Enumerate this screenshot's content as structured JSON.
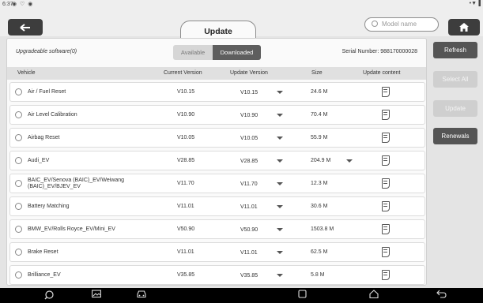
{
  "status_bar": {
    "time": "6:37",
    "icons": "◉ ♡ ◉",
    "right": "•▼▐"
  },
  "header": {
    "title": "Update",
    "search_placeholder": "Model name",
    "back_icon": "back-arrow-icon",
    "home_icon": "home-icon"
  },
  "panel": {
    "upgradeable_label": "Upgradeable software(0)",
    "tab_available": "Available",
    "tab_downloaded": "Downloaded",
    "serial": "Serial Number:  988170000028"
  },
  "columns": {
    "vehicle": "Vehicle",
    "current": "Current Version",
    "update": "Update Version",
    "size": "Size",
    "content": "Update content"
  },
  "rows": [
    {
      "name": "Air / Fuel Reset",
      "current": "V10.15",
      "update": "V10.15",
      "size": "24.6 M"
    },
    {
      "name": "Air Level Calibration",
      "current": "V10.90",
      "update": "V10.90",
      "size": "70.4 M"
    },
    {
      "name": "Airbag Reset",
      "current": "V10.05",
      "update": "V10.05",
      "size": "55.9 M"
    },
    {
      "name": "Audi_EV",
      "current": "V28.85",
      "update": "V28.85",
      "size": "204.9 M"
    },
    {
      "name": "BAIC_EV/Senova (BAIC)_EV/Weiwang (BAIC)_EV/BJEV_EV",
      "current": "V11.70",
      "update": "V11.70",
      "size": "12.3 M"
    },
    {
      "name": "Battery Matching",
      "current": "V11.01",
      "update": "V11.01",
      "size": "30.6 M"
    },
    {
      "name": "BMW_EV/Rolls Royce_EV/Mini_EV",
      "current": "V50.90",
      "update": "V50.90",
      "size": "1503.8 M"
    },
    {
      "name": "Brake Reset",
      "current": "V11.01",
      "update": "V11.01",
      "size": "62.5 M"
    },
    {
      "name": "Brilliance_EV",
      "current": "V35.85",
      "update": "V35.85",
      "size": "5.8 M"
    }
  ],
  "sidebar": {
    "refresh": "Refresh",
    "select_all": "Select All",
    "update": "Update",
    "renewals": "Renewals"
  },
  "navbar": {
    "icons": [
      "wrench-icon",
      "image-icon",
      "car-icon",
      "recents-icon",
      "home-icon",
      "back-icon"
    ]
  }
}
